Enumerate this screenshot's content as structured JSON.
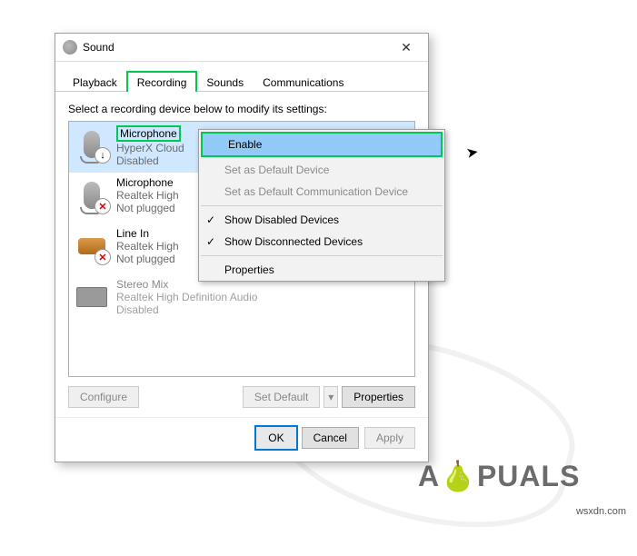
{
  "window": {
    "title": "Sound"
  },
  "tabs": {
    "playback": "Playback",
    "recording": "Recording",
    "sounds": "Sounds",
    "communications": "Communications"
  },
  "hint": "Select a recording device below to modify its settings:",
  "devices": [
    {
      "name": "Microphone",
      "sub1": "HyperX Cloud",
      "sub2": "Disabled"
    },
    {
      "name": "Microphone",
      "sub1": "Realtek High",
      "sub2": "Not plugged"
    },
    {
      "name": "Line In",
      "sub1": "Realtek High",
      "sub2": "Not plugged"
    },
    {
      "name": "Stereo Mix",
      "sub1": "Realtek High Definition Audio",
      "sub2": "Disabled"
    }
  ],
  "context_menu": {
    "enable": "Enable",
    "set_default": "Set as Default Device",
    "set_comm": "Set as Default Communication Device",
    "show_disabled": "Show Disabled Devices",
    "show_disconnected": "Show Disconnected Devices",
    "properties": "Properties"
  },
  "buttons": {
    "configure": "Configure",
    "set_default": "Set Default",
    "properties": "Properties",
    "ok": "OK",
    "cancel": "Cancel",
    "apply": "Apply"
  },
  "watermark": {
    "pre": "A",
    "mid": "🍐",
    "post": "PUALS"
  },
  "credit": "wsxdn.com"
}
